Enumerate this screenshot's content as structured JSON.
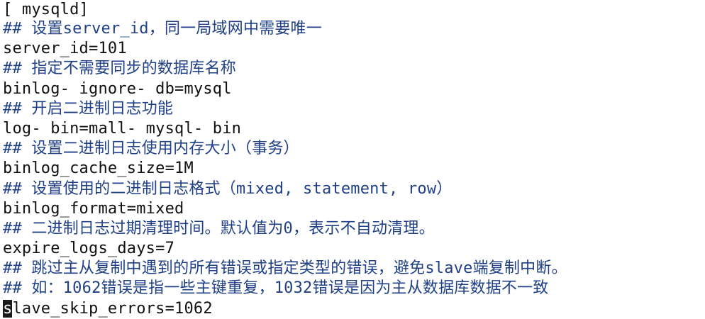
{
  "editor": {
    "lines": [
      {
        "kind": "code",
        "text": "[ mysqld]"
      },
      {
        "kind": "comment",
        "text": "## 设置server_id，同一局域网中需要唯一"
      },
      {
        "kind": "code",
        "text": "server_id=101"
      },
      {
        "kind": "comment",
        "text": "## 指定不需要同步的数据库名称"
      },
      {
        "kind": "code",
        "text": "binlog- ignore- db=mysql"
      },
      {
        "kind": "comment",
        "text": "## 开启二进制日志功能"
      },
      {
        "kind": "code",
        "text": "log- bin=mall- mysql- bin"
      },
      {
        "kind": "comment",
        "text": "## 设置二进制日志使用内存大小（事务）"
      },
      {
        "kind": "code",
        "text": "binlog_cache_size=1M"
      },
      {
        "kind": "comment",
        "text": "## 设置使用的二进制日志格式（mixed, statement, row）"
      },
      {
        "kind": "code",
        "text": "binlog_format=mixed"
      },
      {
        "kind": "comment",
        "text": "## 二进制日志过期清理时间。默认值为0，表示不自动清理。"
      },
      {
        "kind": "code",
        "text": "expire_logs_days=7"
      },
      {
        "kind": "comment",
        "text": "## 跳过主从复制中遇到的所有错误或指定类型的错误，避免slave端复制中断。"
      },
      {
        "kind": "comment",
        "text": "## 如：1062错误是指一些主键重复，1032错误是因为主从数据库数据不一致"
      }
    ],
    "cursor_line": {
      "cursor_char": "s",
      "rest": "lave_skip_errors=1062"
    }
  }
}
